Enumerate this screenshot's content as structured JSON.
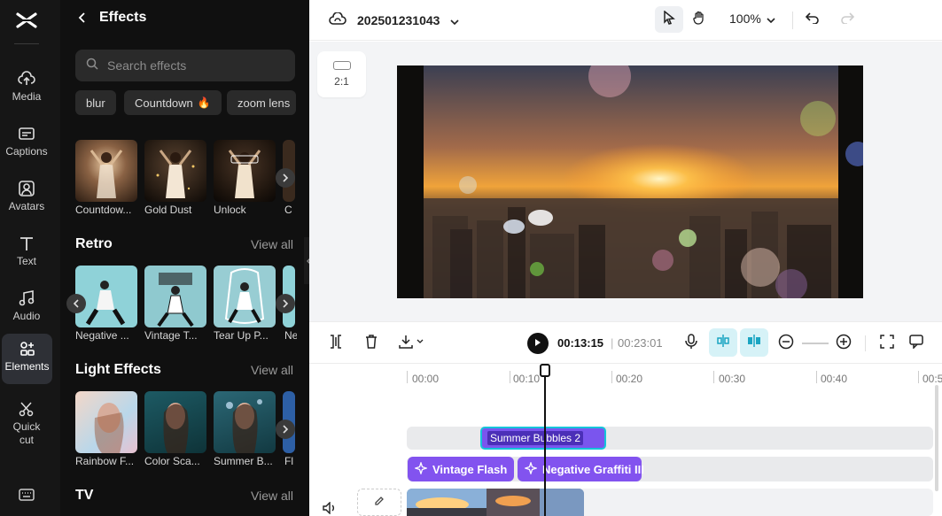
{
  "rail": {
    "items": [
      {
        "label": "Media",
        "icon": "cloud-upload-icon"
      },
      {
        "label": "Captions",
        "icon": "captions-icon"
      },
      {
        "label": "Avatars",
        "icon": "avatar-icon"
      },
      {
        "label": "Text",
        "icon": "text-icon"
      },
      {
        "label": "Audio",
        "icon": "music-note-icon"
      },
      {
        "label": "Elements",
        "icon": "elements-icon",
        "active": true
      },
      {
        "label": "Quick",
        "label2": "cut",
        "icon": "scissors-icon"
      }
    ]
  },
  "panel": {
    "title": "Effects",
    "search_placeholder": "Search effects",
    "chips": [
      "blur",
      "Countdown",
      "zoom lens"
    ],
    "top_row": [
      "Countdow...",
      "Gold Dust",
      "Unlock",
      "C"
    ],
    "sections": [
      {
        "title": "Retro",
        "view_all": "View all",
        "items": [
          "Negative ...",
          "Vintage T...",
          "Tear Up P...",
          "Ne"
        ]
      },
      {
        "title": "Light Effects",
        "view_all": "View all",
        "items": [
          "Rainbow F...",
          "Color Sca...",
          "Summer B...",
          "Fl"
        ]
      },
      {
        "title": "TV",
        "view_all": "View all"
      }
    ]
  },
  "topbar": {
    "project_name": "202501231043",
    "zoom": "100%"
  },
  "canvas": {
    "ratio": "2:1"
  },
  "timeline_toolbar": {
    "current_time": "00:13:15",
    "separator": "|",
    "duration": "00:23:01"
  },
  "timeline": {
    "ruler": [
      "00:00",
      "00:10",
      "00:20",
      "00:30",
      "00:40",
      "00:5"
    ],
    "effect_clip": "Summer Bubbles 2",
    "fx_clips": [
      "Vintage Flash",
      "Negative Graffiti III"
    ]
  },
  "colors": {
    "accent_purple": "#8253ef",
    "selection_cyan": "#14c4d9",
    "panel_bg": "#101010",
    "rail_bg": "#161616"
  }
}
